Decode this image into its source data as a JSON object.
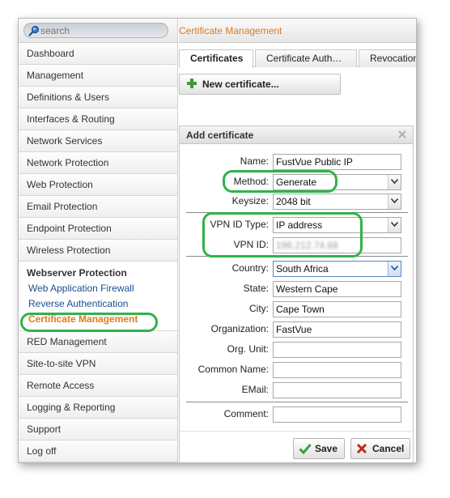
{
  "sidebar": {
    "search_placeholder": "search",
    "items_top": [
      "Dashboard",
      "Management",
      "Definitions & Users",
      "Interfaces & Routing",
      "Network Services",
      "Network Protection",
      "Web Protection",
      "Email Protection",
      "Endpoint Protection",
      "Wireless Protection"
    ],
    "group": {
      "title": "Webserver Protection",
      "items": [
        "Web Application Firewall",
        "Reverse Authentication",
        "Certificate Management"
      ],
      "active": "Certificate Management"
    },
    "items_bottom": [
      "RED Management",
      "Site-to-site VPN",
      "Remote Access",
      "Logging & Reporting",
      "Support",
      "Log off"
    ]
  },
  "main": {
    "title": "Certificate Management",
    "tabs": [
      {
        "label": "Certificates",
        "active": true
      },
      {
        "label": "Certificate Auth…",
        "active": false
      },
      {
        "label": "Revocation",
        "active": false
      }
    ],
    "new_button": "New certificate..."
  },
  "dialog": {
    "title": "Add certificate",
    "name_label": "Name:",
    "name_value": "FustVue Public IP",
    "method_label": "Method:",
    "method_value": "Generate",
    "keysize_label": "Keysize:",
    "keysize_value": "2048 bit",
    "vpn_id_type_label": "VPN ID Type:",
    "vpn_id_type_value": "IP address",
    "vpn_id_label": "VPN ID:",
    "vpn_id_value": "196.212.74.68",
    "country_label": "Country:",
    "country_value": "South Africa",
    "state_label": "State:",
    "state_value": "Western Cape",
    "city_label": "City:",
    "city_value": "Cape Town",
    "org_label": "Organization:",
    "org_value": "FastVue",
    "org_unit_label": "Org. Unit:",
    "org_unit_value": "",
    "common_name_label": "Common Name:",
    "common_name_value": "",
    "email_label": "EMail:",
    "email_value": "",
    "comment_label": "Comment:",
    "comment_value": "",
    "save": "Save",
    "cancel": "Cancel"
  },
  "colors": {
    "accent": "#e07b1a",
    "link": "#1b4f8f",
    "highlight": "#2fb34a",
    "save_icon": "#3aa13a",
    "cancel_icon": "#c0281e"
  }
}
